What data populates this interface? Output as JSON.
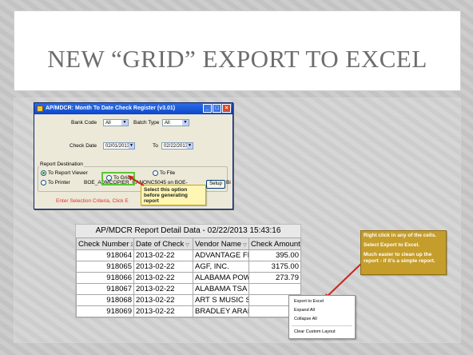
{
  "slide": {
    "title": "NEW “GRID” EXPORT TO EXCEL"
  },
  "dialog": {
    "title": "AP/MDCR: Month To Date Check Register (v3.01)",
    "bank_code_label": "Bank Code",
    "bank_code_value": "All",
    "batch_type_label": "Batch Type",
    "batch_type_value": "All",
    "check_date_label": "Check Date",
    "from_date": "02/01/2013",
    "to_label": "To",
    "to_date": "02/22/2013",
    "report_destination_label": "Report Destination",
    "radio_report_viewer": "To Report Viewer",
    "radio_grid": "To Grid",
    "radio_file": "To File",
    "radio_printer": "To Printer",
    "printer_name": "BOE_ADMCOPIER_CANONC5045 on BOE-",
    "setup_button": "Setup",
    "setup_trailing": "Bi",
    "status_text": "Enter Selection Criteria, Click E"
  },
  "callout_grid": "Select this option before generating report",
  "callout_excel": {
    "line1": "Right click in any of the cells.",
    "line2": "Select Export to Excel.",
    "line3": "Much easier to clean up the report - if it’s a simple report."
  },
  "grid": {
    "title": "AP/MDCR Report Detail Data - 02/22/2013 15:43:16",
    "columns": [
      "Check Number",
      "Date of Check",
      "Vendor Name",
      "Check Amount"
    ],
    "rows": [
      [
        "918064",
        "2013-02-22",
        "ADVANTAGE FIN",
        "395.00"
      ],
      [
        "918065",
        "2013-02-22",
        "AGF, INC.",
        "3175.00"
      ],
      [
        "918066",
        "2013-02-22",
        "ALABAMA POWE",
        "273.79"
      ],
      [
        "918067",
        "2013-02-22",
        "ALABAMA TSA",
        ""
      ],
      [
        "918068",
        "2013-02-22",
        "ART S MUSIC S",
        ""
      ],
      [
        "918069",
        "2013-02-22",
        "BRADLEY ARAN",
        ""
      ]
    ]
  },
  "context_menu": [
    "Export to Excel",
    "Expand All",
    "Collapse All",
    "Clear Custom Layout"
  ]
}
